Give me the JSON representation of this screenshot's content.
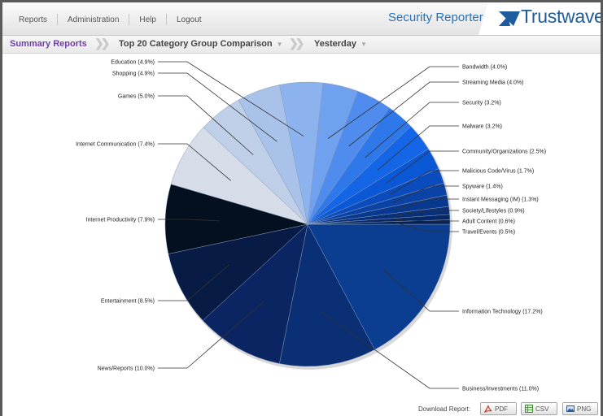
{
  "nav": {
    "items": [
      "Reports",
      "Administration",
      "Help",
      "Logout"
    ]
  },
  "header": {
    "app_title": "Security Reporter",
    "logo_text": "Trustwave",
    "logo_mark": "®"
  },
  "breadcrumb": {
    "root": "Summary Reports",
    "report": "Top 20 Category Group Comparison",
    "period": "Yesterday"
  },
  "chart_data": {
    "type": "pie",
    "title": "",
    "slices": [
      {
        "label": "Information Technology (17.2%)",
        "value": 17.2,
        "color": "#0b3d91"
      },
      {
        "label": "Business/Investments (11.0%)",
        "value": 11.0,
        "color": "#0a2f75"
      },
      {
        "label": "News/Reports (10.0%)",
        "value": 10.0,
        "color": "#0a2561"
      },
      {
        "label": "Entertainment (8.5%)",
        "value": 8.5,
        "color": "#081b45"
      },
      {
        "label": "Internet Productivity (7.9%)",
        "value": 7.9,
        "color": "#04101f"
      },
      {
        "label": "Internet Communication (7.4%)",
        "value": 7.4,
        "color": "#d6dde8"
      },
      {
        "label": "Games (5.0%)",
        "value": 5.0,
        "color": "#bfcfe7"
      },
      {
        "label": "Shopping (4.9%)",
        "value": 4.9,
        "color": "#a8c2ea"
      },
      {
        "label": "Education (4.9%)",
        "value": 4.9,
        "color": "#8db3ee"
      },
      {
        "label": "Bandwidth (4.0%)",
        "value": 4.0,
        "color": "#6fa1ee"
      },
      {
        "label": "Streaming Media (4.0%)",
        "value": 4.0,
        "color": "#4f8ced"
      },
      {
        "label": "Security (3.2%)",
        "value": 3.2,
        "color": "#2f78ea"
      },
      {
        "label": "Malware (3.2%)",
        "value": 3.2,
        "color": "#1466e6"
      },
      {
        "label": "Community/Organizations (2.5%)",
        "value": 2.5,
        "color": "#0b58d6"
      },
      {
        "label": "Malicious Code/Virus (1.7%)",
        "value": 1.7,
        "color": "#0a4cbd"
      },
      {
        "label": "Spyware (1.4%)",
        "value": 1.4,
        "color": "#0a42a5"
      },
      {
        "label": "Instant Messaging (IM) (1.3%)",
        "value": 1.3,
        "color": "#09398f"
      },
      {
        "label": "Society/Lifestyles (0.9%)",
        "value": 0.9,
        "color": "#08307a"
      },
      {
        "label": "Adult Content (0.6%)",
        "value": 0.6,
        "color": "#072866"
      },
      {
        "label": "Travel/Events (0.5%)",
        "value": 0.5,
        "color": "#062055"
      }
    ]
  },
  "footer": {
    "download_label": "Download Report:",
    "buttons": [
      "PDF",
      "CSV",
      "PNG"
    ]
  }
}
